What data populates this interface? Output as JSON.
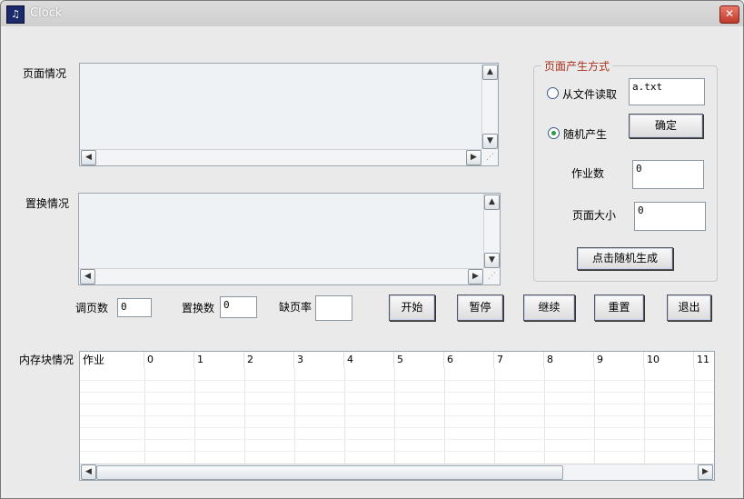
{
  "window": {
    "title": "Clock",
    "close_glyph": "✕",
    "app_icon": "app-icon"
  },
  "left_panel": {
    "page_label": "页面情况",
    "replace_label": "置换情况"
  },
  "stats": {
    "page_calls_label": "调页数",
    "page_calls_value": "0",
    "replacements_label": "置换数",
    "replacements_value": "0",
    "fault_rate_label": "缺页率",
    "fault_rate_value": ""
  },
  "controls": {
    "start": "开始",
    "pause": "暂停",
    "continue": "继续",
    "reset": "重置",
    "exit": "退出"
  },
  "generation": {
    "group_title": "页面产生方式",
    "from_file_label": "从文件读取",
    "file_value": "a.txt",
    "random_label": "随机产生",
    "random_selected": true,
    "confirm_button": "确定",
    "jobs_label": "作业数",
    "jobs_value": "0",
    "page_size_label": "页面大小",
    "page_size_value": "0",
    "generate_button": "点击随机生成"
  },
  "memory": {
    "label": "内存块情况",
    "columns": [
      "作业",
      "0",
      "1",
      "2",
      "3",
      "4",
      "5",
      "6",
      "7",
      "8",
      "9",
      "10",
      "11"
    ]
  },
  "icons": {
    "scroll_up": "▲",
    "scroll_down": "▼",
    "scroll_left": "◀",
    "scroll_right": "▶",
    "grip": "⋰"
  }
}
